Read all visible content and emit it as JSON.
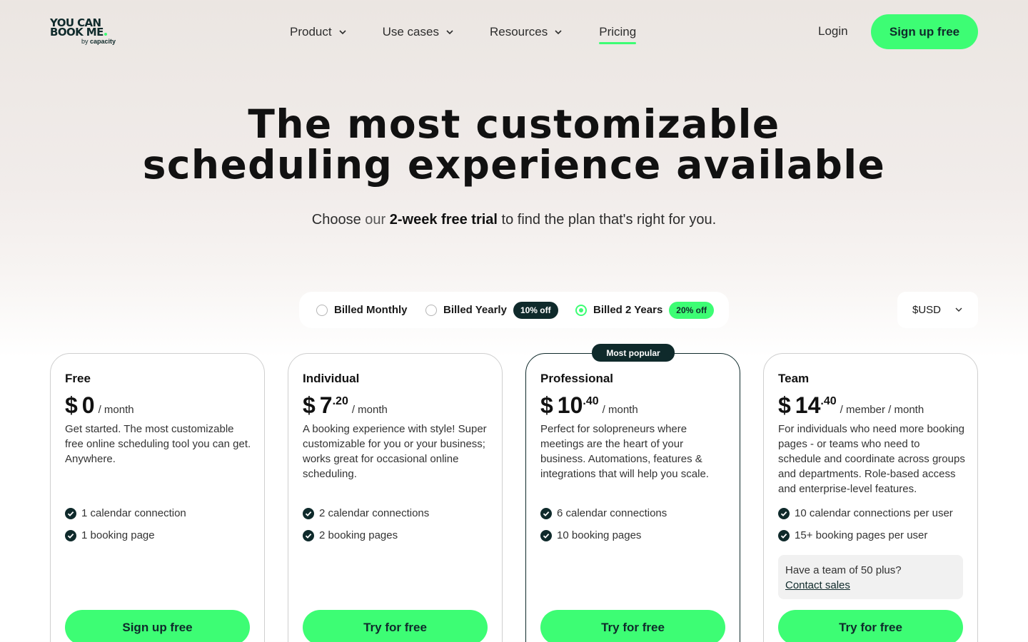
{
  "logo": {
    "line1": "YOU CAN",
    "line2": "BOOK ME",
    "by": "by",
    "brand": "capacity"
  },
  "nav": {
    "items": [
      {
        "label": "Product"
      },
      {
        "label": "Use cases"
      },
      {
        "label": "Resources"
      },
      {
        "label": "Pricing"
      }
    ],
    "active": "Pricing",
    "login": "Login",
    "signup": "Sign up free"
  },
  "hero": {
    "title_line1": "The most customizable",
    "title_line2": "scheduling experience available",
    "sub_pre": "Choose",
    "sub_muted": " our ",
    "sub_bold": "2-week free trial",
    "sub_post": " to find the plan that's right for you."
  },
  "billing": {
    "options": [
      {
        "label": "Billed Monthly",
        "badge": "",
        "selected": false
      },
      {
        "label": "Billed Yearly",
        "badge": "10% off",
        "selected": false
      },
      {
        "label": "Billed 2 Years",
        "badge": "20% off",
        "selected": true
      }
    ],
    "currency": "$USD"
  },
  "popular_badge": "Most popular",
  "plans": [
    {
      "name": "Free",
      "currency": "$",
      "int": "0",
      "dec": "",
      "per": "/ month",
      "desc": "Get started. The most customizable free online scheduling tool you can get. Anywhere.",
      "features": [
        "1 calendar connection",
        "1 booking page"
      ],
      "cta": "Sign up free"
    },
    {
      "name": "Individual",
      "currency": "$",
      "int": "7",
      "dec": ".20",
      "per": "/ month",
      "desc": "A booking experience with style! Super customizable for you or your business; works great for occasional online scheduling.",
      "features": [
        "2 calendar connections",
        "2 booking pages"
      ],
      "cta": "Try for free"
    },
    {
      "name": "Professional",
      "currency": "$",
      "int": "10",
      "dec": ".40",
      "per": "/ month",
      "desc": "Perfect for solopreneurs where meetings are the heart of your business. Automations, features & integrations that will help you scale.",
      "features": [
        "6 calendar connections",
        "10 booking pages"
      ],
      "cta": "Try for free"
    },
    {
      "name": "Team",
      "currency": "$",
      "int": "14",
      "dec": ".40",
      "per": "/ member / month",
      "desc": "For individuals who need more booking pages - or teams who need to schedule and coordinate across groups and departments. Role-based access and enterprise-level features.",
      "features": [
        "10 calendar connections per user",
        "15+ booking pages per user"
      ],
      "contact_text": "Have a team of 50 plus?",
      "contact_link": "Contact sales",
      "cta": "Try for free"
    }
  ],
  "colors": {
    "accent": "#3dfd74",
    "dark": "#0f2a2b"
  },
  "icons": {
    "nav_chevron": "chevron-down-icon",
    "feature": "check-circle-icon"
  }
}
